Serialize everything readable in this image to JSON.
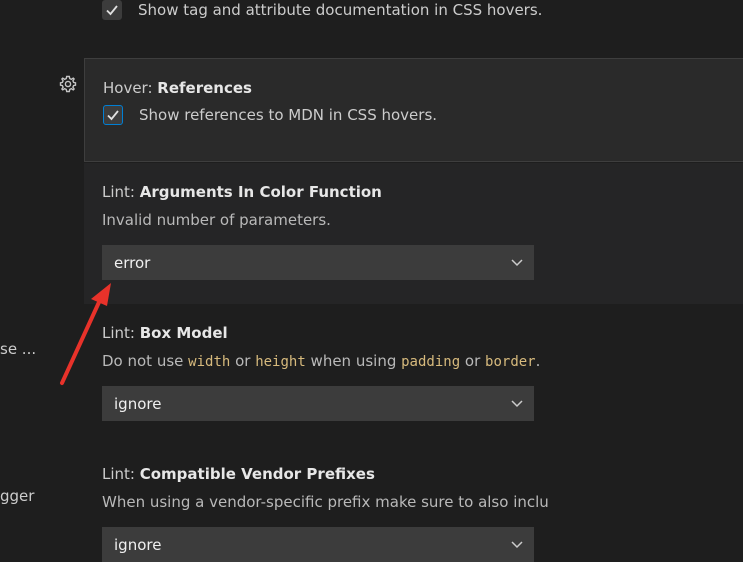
{
  "left_labels": [
    "se ...",
    "gger"
  ],
  "settings": {
    "tag_docs": {
      "checkbox_label": "Show tag and attribute documentation in CSS hovers.",
      "checked": true
    },
    "hover_references": {
      "category": "Hover: ",
      "name": "References",
      "checkbox_label": "Show references to MDN in CSS hovers.",
      "checked": true
    },
    "lint_color_function": {
      "category": "Lint: ",
      "name": "Arguments In Color Function",
      "description": "Invalid number of parameters.",
      "value": "error"
    },
    "lint_box_model": {
      "category": "Lint: ",
      "name": "Box Model",
      "desc_parts": [
        "Do not use ",
        "width",
        " or ",
        "height",
        " when using ",
        "padding",
        " or ",
        "border",
        "."
      ],
      "value": "ignore"
    },
    "lint_vendor_prefixes": {
      "category": "Lint: ",
      "name": "Compatible Vendor Prefixes",
      "description": "When using a vendor-specific prefix make sure to also inclu",
      "value": "ignore"
    }
  },
  "icons": {
    "gear": "gear-icon",
    "check": "check-icon",
    "chevron": "chevron-down-icon",
    "annotation": "annotation-arrow"
  },
  "colors": {
    "background": "#1e1e1e",
    "focused_row": "#252526",
    "dropdown": "#3c3c3c",
    "focus_border": "#007fd4",
    "code_text": "#d7ba7d",
    "arrow": "#e8322a"
  }
}
